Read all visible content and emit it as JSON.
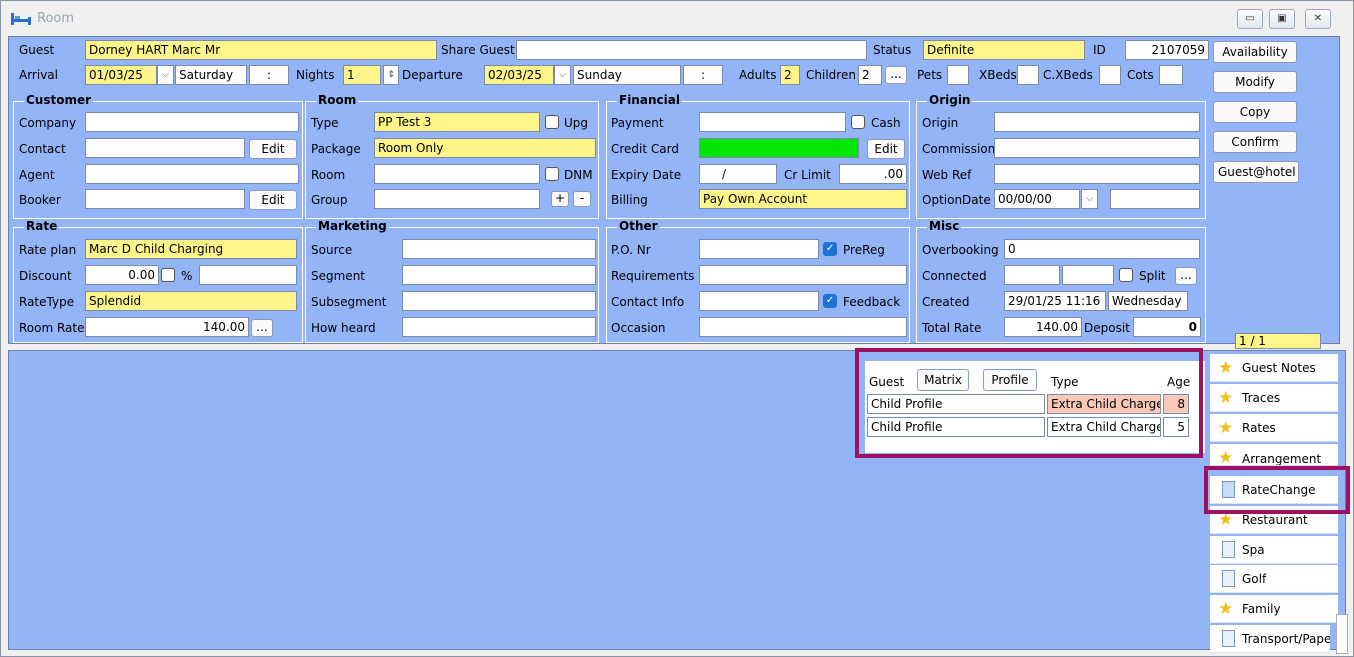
{
  "window": {
    "title": "Room",
    "ctrl_min": "▭",
    "ctrl_max": "▣",
    "ctrl_close": "✕"
  },
  "guest": {
    "label": "Guest",
    "value": "Dorney HART Marc Mr",
    "share_label": "Share Guest",
    "share_value": "",
    "status_label": "Status",
    "status_value": "Definite",
    "id_label": "ID",
    "id_value": "2107059"
  },
  "dates": {
    "arrival_label": "Arrival",
    "arrival_value": "01/03/25",
    "arrival_day": "Saturday",
    "arrival_time": ":",
    "nights_label": "Nights",
    "nights_value": "1",
    "departure_label": "Departure",
    "departure_value": "02/03/25",
    "departure_day": "Sunday",
    "departure_time": ":",
    "adults_label": "Adults",
    "adults_value": "2",
    "children_label": "Children",
    "children_value": "2",
    "ellipsis": "...",
    "pets_label": "Pets",
    "xbeds_label": "XBeds",
    "cxbeds_label": "C.XBeds",
    "cots_label": "Cots"
  },
  "customer": {
    "title": "Customer",
    "company_label": "Company",
    "contact_label": "Contact",
    "agent_label": "Agent",
    "booker_label": "Booker",
    "edit1": "Edit",
    "edit2": "Edit"
  },
  "room": {
    "title": "Room",
    "type_label": "Type",
    "type_value": "PP Test 3",
    "upg_label": "Upg",
    "package_label": "Package",
    "package_value": "Room Only",
    "room_label": "Room",
    "dnm_label": "DNM",
    "group_label": "Group",
    "plus": "+",
    "minus": "-"
  },
  "financial": {
    "title": "Financial",
    "payment_label": "Payment",
    "cash_label": "Cash",
    "cc_label": "Credit Card",
    "edit": "Edit",
    "expiry_label": "Expiry Date",
    "expiry_value": "/",
    "crlimit_label": "Cr Limit",
    "crlimit_value": ".00",
    "billing_label": "Billing",
    "billing_value": "Pay Own Account"
  },
  "origin": {
    "title": "Origin",
    "origin_label": "Origin",
    "commission_label": "Commission",
    "webref_label": "Web Ref",
    "optiondate_label": "OptionDate",
    "optiondate_value": "00/00/00"
  },
  "rate": {
    "title": "Rate",
    "plan_label": "Rate plan",
    "plan_value": "Marc D Child Charging",
    "discount_label": "Discount",
    "discount_value": "0.00",
    "pct": "%",
    "ratetype_label": "RateType",
    "ratetype_value": "Splendid",
    "roomrate_label": "Room Rate",
    "roomrate_value": "140.00",
    "ellipsis": "..."
  },
  "marketing": {
    "title": "Marketing",
    "source_label": "Source",
    "segment_label": "Segment",
    "subsegment_label": "Subsegment",
    "howheard_label": "How heard"
  },
  "other": {
    "title": "Other",
    "po_label": "P.O. Nr",
    "prereg_label": "PreReg",
    "req_label": "Requirements",
    "contact_label": "Contact Info",
    "feedback_label": "Feedback",
    "occasion_label": "Occasion"
  },
  "misc": {
    "title": "Misc",
    "overbooking_label": "Overbooking",
    "overbooking_value": "0",
    "connected_label": "Connected",
    "split_label": "Split",
    "ellipsis": "...",
    "created_label": "Created",
    "created_value": "29/01/25 11:16",
    "created_day": "Wednesday",
    "total_label": "Total Rate",
    "total_value": "140.00",
    "deposit_label": "Deposit",
    "deposit_value": "0"
  },
  "actions": {
    "availability": "Availability",
    "modify": "Modify",
    "copy": "Copy",
    "confirm": "Confirm",
    "guesthotel": "Guest@hotel",
    "page": "1 / 1"
  },
  "children_grid": {
    "guest_header": "Guest",
    "matrix_btn": "Matrix",
    "profile_btn": "Profile",
    "type_header": "Type",
    "age_header": "Age",
    "rows": [
      {
        "guest": "Child Profile",
        "type": "Extra Child Charge",
        "age": "8"
      },
      {
        "guest": "Child Profile",
        "type": "Extra Child Charge",
        "age": "5"
      }
    ]
  },
  "sidebar": {
    "items": [
      {
        "label": "Guest Notes"
      },
      {
        "label": "Traces"
      },
      {
        "label": "Rates"
      },
      {
        "label": "Arrangement"
      },
      {
        "label": "RateChange"
      },
      {
        "label": "Restaurant"
      },
      {
        "label": "Spa"
      },
      {
        "label": "Golf"
      },
      {
        "label": "Family"
      },
      {
        "label": "Transport/Paper"
      }
    ]
  },
  "colors": {
    "panel": "#94b4f8",
    "yellow": "#fdf58a",
    "green": "#00e600",
    "pink": "#f8c8b8",
    "highlight": "#a01060"
  }
}
